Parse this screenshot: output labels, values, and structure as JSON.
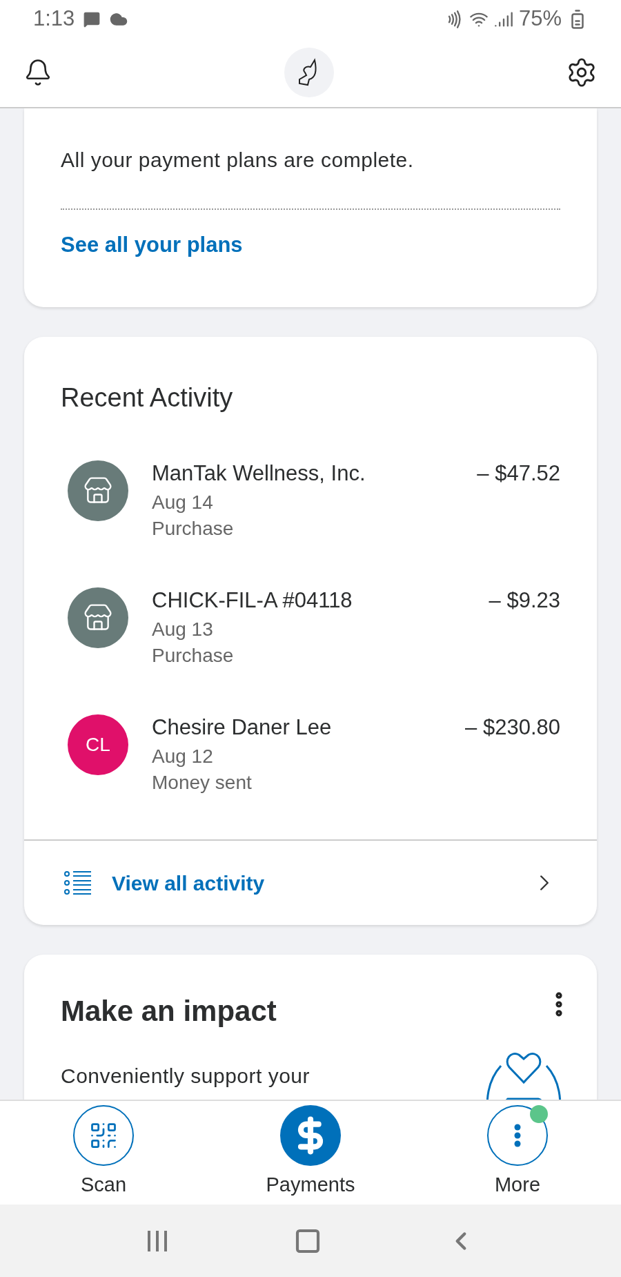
{
  "status_bar": {
    "time": "1:13",
    "battery": "75%"
  },
  "plans_card": {
    "message": "All your payment plans are complete.",
    "link": "See all your plans"
  },
  "activity": {
    "title": "Recent Activity",
    "items": [
      {
        "name": "ManTak Wellness, Inc.",
        "date": "Aug 14",
        "type": "Purchase",
        "amount": "– $47.52",
        "avatar": {
          "kind": "merchant"
        }
      },
      {
        "name": "CHICK-FIL-A #04118",
        "date": "Aug 13",
        "type": "Purchase",
        "amount": "– $9.23",
        "avatar": {
          "kind": "merchant"
        }
      },
      {
        "name": "Chesire Daner Lee",
        "date": "Aug 12",
        "type": "Money sent",
        "amount": "– $230.80",
        "avatar": {
          "kind": "initials",
          "initials": "CL",
          "color": "#e0106a"
        }
      }
    ],
    "footer_link": "View all activity"
  },
  "impact_card": {
    "title": "Make an impact",
    "text": "Conveniently support your"
  },
  "bottom_nav": [
    {
      "label": "Scan",
      "kind": "scan",
      "selected": false,
      "badge": false
    },
    {
      "label": "Payments",
      "kind": "payments",
      "selected": true,
      "badge": false
    },
    {
      "label": "More",
      "kind": "more",
      "selected": false,
      "badge": true
    }
  ]
}
